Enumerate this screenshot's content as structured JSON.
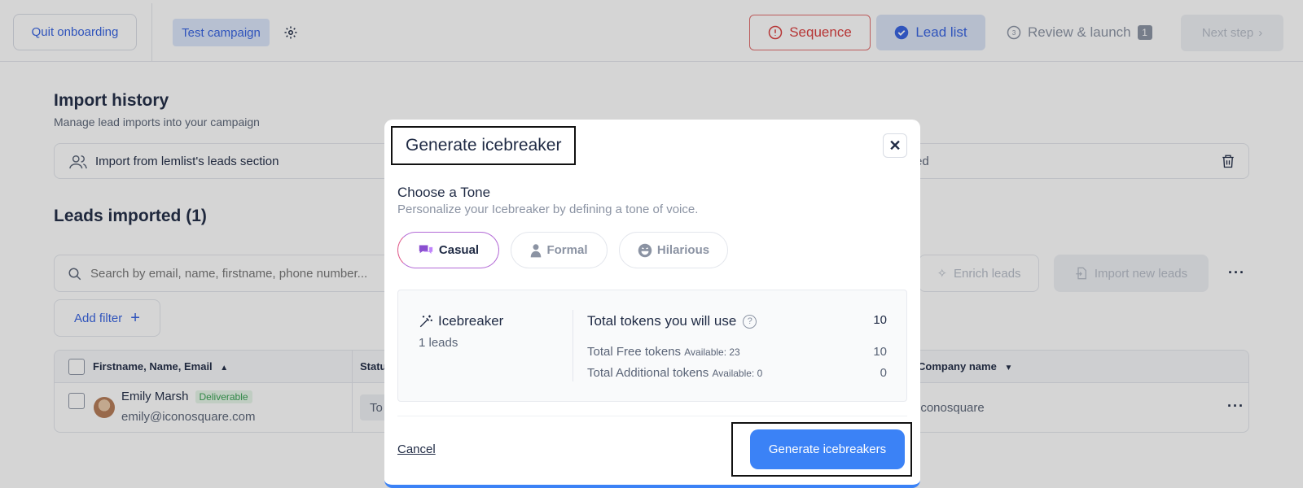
{
  "topbar": {
    "quit_label": "Quit onboarding",
    "campaign_label": "Test campaign",
    "steps": {
      "sequence": "Sequence",
      "lead_list": "Lead list",
      "review": "Review & launch",
      "review_badge": "1"
    },
    "next_label": "Next step"
  },
  "import_history": {
    "title": "Import history",
    "subtitle": "Manage lead imports into your campaign",
    "row_label": "Import from lemlist's leads section",
    "row_status_partial": "ed"
  },
  "leads": {
    "title": "Leads imported (1)",
    "search_placeholder": "Search by email, name, firstname, phone number...",
    "enrich_label": "Enrich leads",
    "import_new_label": "Import new leads",
    "add_filter_label": "Add filter",
    "columns": {
      "name": "Firstname, Name, Email",
      "status": "Statu",
      "company": "Company name"
    },
    "rows": [
      {
        "name": "Emily Marsh",
        "badge": "Deliverable",
        "email": "emily@iconosquare.com",
        "status": "To",
        "company": "iconosquare"
      }
    ]
  },
  "modal": {
    "title": "Generate icebreaker",
    "close_label": "✕",
    "choose_title": "Choose a Tone",
    "choose_subtitle": "Personalize your Icebreaker by defining a tone of voice.",
    "tones": [
      "Casual",
      "Formal",
      "Hilarious"
    ],
    "selected_tone": "Casual",
    "summary": {
      "label": "Icebreaker",
      "leads": "1 leads",
      "total_title": "Total tokens you will use",
      "total_value": "10",
      "free_label": "Total Free tokens",
      "free_available": "Available: 23",
      "free_value": "10",
      "additional_label": "Total Additional tokens",
      "additional_available": "Available: 0",
      "additional_value": "0"
    },
    "cancel_label": "Cancel",
    "generate_label": "Generate icebreakers"
  },
  "colors": {
    "accent": "#3461e0",
    "primary_button": "#3b82f6",
    "sequence_error": "#d93b3b",
    "deliverable": "#36a150"
  }
}
